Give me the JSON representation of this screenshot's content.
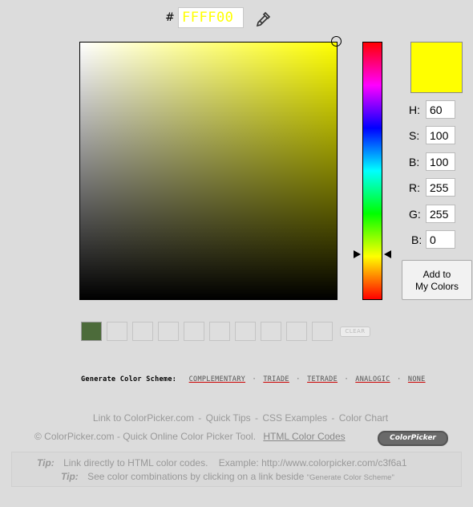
{
  "hex": {
    "hash": "#",
    "value": "FFFF00",
    "dropper_icon": "eyedropper-icon"
  },
  "picker": {
    "current_color": "#ffff00",
    "hue_marker_value": 60
  },
  "fields": [
    {
      "label": "H:",
      "value": "60"
    },
    {
      "label": "S:",
      "value": "100"
    },
    {
      "label": "B:",
      "value": "100"
    },
    {
      "label": "R:",
      "value": "255"
    },
    {
      "label": "G:",
      "value": "255"
    },
    {
      "label": "B:",
      "value": "0"
    }
  ],
  "add_button": {
    "line1": "Add to",
    "line2": "My Colors"
  },
  "saved_swatches": [
    "#4c6b3a",
    "",
    "",
    "",
    "",
    "",
    "",
    "",
    "",
    ""
  ],
  "clear_label": "CLEAR",
  "scheme": {
    "label": "Generate Color Scheme:",
    "links": [
      "COMPLEMENTARY",
      "TRIADE",
      "TETRADE",
      "ANALOGIC",
      "NONE"
    ],
    "separator": "·"
  },
  "footer": {
    "links": [
      "Link to ColorPicker.com",
      "Quick Tips",
      "CSS Examples",
      "Color Chart"
    ],
    "separator": "-",
    "copyright": "© ColorPicker.com - Quick Online Color Picker Tool.",
    "html_codes": "HTML Color Codes",
    "badge": "ColorPicker"
  },
  "tips": [
    {
      "tip": "Tip:",
      "text": "Link directly to HTML color codes.    Example: http://www.colorpicker.com/c3f6a1",
      "small": ""
    },
    {
      "tip": "Tip:",
      "text": "See color combinations by clicking on a link beside",
      "small": "\"Generate Color Scheme\""
    }
  ]
}
